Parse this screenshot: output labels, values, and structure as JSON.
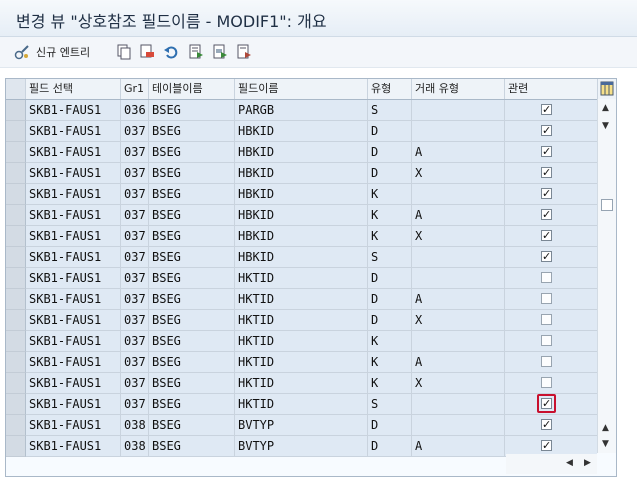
{
  "window": {
    "title": "변경 뷰 \"상호참조 필드이름 - MODIF1\": 개요"
  },
  "toolbar": {
    "new_entries_label": "신규 엔트리",
    "icons": [
      "display-change-icon",
      "copy-icon",
      "delete-icon",
      "undo-icon",
      "select-all-icon",
      "select-block-icon",
      "deselect-all-icon"
    ]
  },
  "table": {
    "columns": [
      "필드 선택",
      "Gr1",
      "테이블이름",
      "필드이름",
      "유형",
      "거래 유형",
      "관련"
    ],
    "rows": [
      {
        "fsel": "SKB1-FAUS1",
        "gr": "036",
        "table": "BSEG",
        "field": "PARGB",
        "type": "S",
        "trans": "",
        "rel": true
      },
      {
        "fsel": "SKB1-FAUS1",
        "gr": "037",
        "table": "BSEG",
        "field": "HBKID",
        "type": "D",
        "trans": "",
        "rel": true
      },
      {
        "fsel": "SKB1-FAUS1",
        "gr": "037",
        "table": "BSEG",
        "field": "HBKID",
        "type": "D",
        "trans": "A",
        "rel": true
      },
      {
        "fsel": "SKB1-FAUS1",
        "gr": "037",
        "table": "BSEG",
        "field": "HBKID",
        "type": "D",
        "trans": "X",
        "rel": true
      },
      {
        "fsel": "SKB1-FAUS1",
        "gr": "037",
        "table": "BSEG",
        "field": "HBKID",
        "type": "K",
        "trans": "",
        "rel": true
      },
      {
        "fsel": "SKB1-FAUS1",
        "gr": "037",
        "table": "BSEG",
        "field": "HBKID",
        "type": "K",
        "trans": "A",
        "rel": true
      },
      {
        "fsel": "SKB1-FAUS1",
        "gr": "037",
        "table": "BSEG",
        "field": "HBKID",
        "type": "K",
        "trans": "X",
        "rel": true
      },
      {
        "fsel": "SKB1-FAUS1",
        "gr": "037",
        "table": "BSEG",
        "field": "HBKID",
        "type": "S",
        "trans": "",
        "rel": true
      },
      {
        "fsel": "SKB1-FAUS1",
        "gr": "037",
        "table": "BSEG",
        "field": "HKTID",
        "type": "D",
        "trans": "",
        "rel": false
      },
      {
        "fsel": "SKB1-FAUS1",
        "gr": "037",
        "table": "BSEG",
        "field": "HKTID",
        "type": "D",
        "trans": "A",
        "rel": false
      },
      {
        "fsel": "SKB1-FAUS1",
        "gr": "037",
        "table": "BSEG",
        "field": "HKTID",
        "type": "D",
        "trans": "X",
        "rel": false
      },
      {
        "fsel": "SKB1-FAUS1",
        "gr": "037",
        "table": "BSEG",
        "field": "HKTID",
        "type": "K",
        "trans": "",
        "rel": false
      },
      {
        "fsel": "SKB1-FAUS1",
        "gr": "037",
        "table": "BSEG",
        "field": "HKTID",
        "type": "K",
        "trans": "A",
        "rel": false
      },
      {
        "fsel": "SKB1-FAUS1",
        "gr": "037",
        "table": "BSEG",
        "field": "HKTID",
        "type": "K",
        "trans": "X",
        "rel": false
      },
      {
        "fsel": "SKB1-FAUS1",
        "gr": "037",
        "table": "BSEG",
        "field": "HKTID",
        "type": "S",
        "trans": "",
        "rel": true,
        "highlight": true
      },
      {
        "fsel": "SKB1-FAUS1",
        "gr": "038",
        "table": "BSEG",
        "field": "BVTYP",
        "type": "D",
        "trans": "",
        "rel": true
      },
      {
        "fsel": "SKB1-FAUS1",
        "gr": "038",
        "table": "BSEG",
        "field": "BVTYP",
        "type": "D",
        "trans": "A",
        "rel": true
      }
    ]
  },
  "colors": {
    "highlight": "#c8102e",
    "row_bg": "#dfe9f4",
    "header_bg": "#eef3f8"
  }
}
